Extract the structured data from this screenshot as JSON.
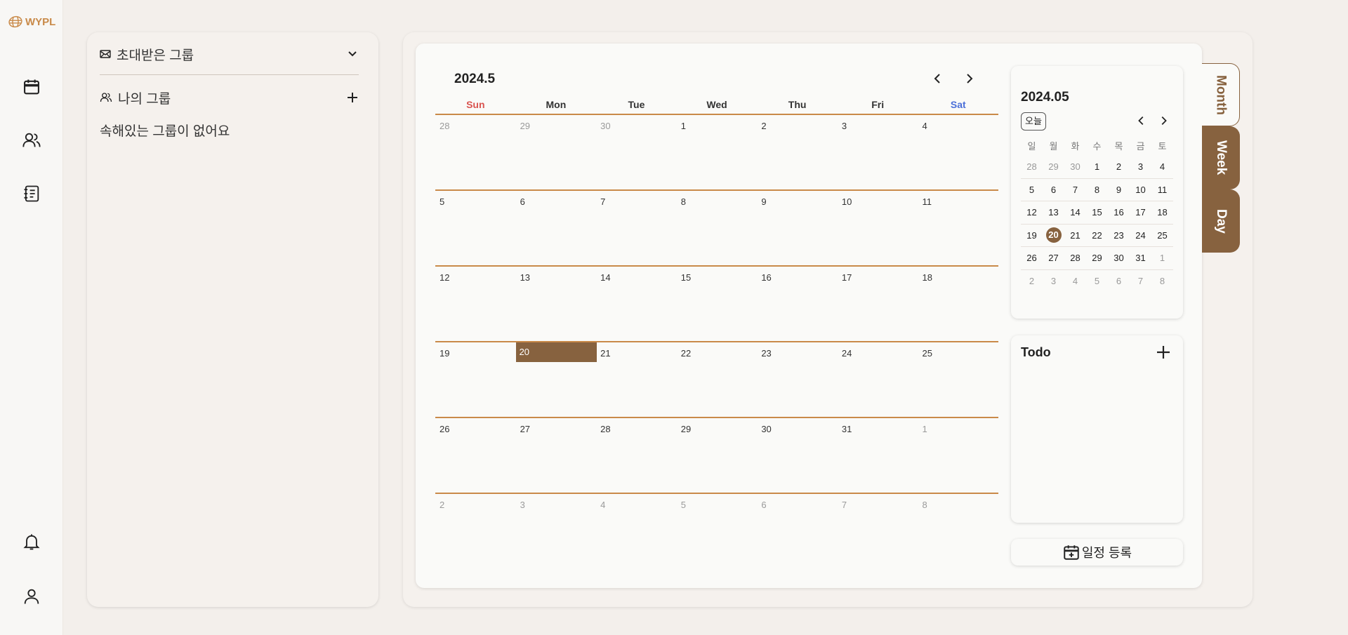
{
  "app": {
    "logo_text": "WYPL"
  },
  "sidebar": {
    "items": [
      {
        "name": "calendar-icon"
      },
      {
        "name": "group-icon"
      },
      {
        "name": "notebook-icon"
      },
      {
        "name": "bell-icon"
      },
      {
        "name": "user-icon"
      }
    ]
  },
  "groups": {
    "invited_label": "초대받은 그룹",
    "my_label": "나의 그룹",
    "empty_text": "속해있는 그룹이 없어요"
  },
  "calendar": {
    "title": "2024.5",
    "weekdays": [
      "Sun",
      "Mon",
      "Tue",
      "Wed",
      "Thu",
      "Fri",
      "Sat"
    ],
    "weeks": [
      [
        [
          "28",
          true
        ],
        [
          "29",
          true
        ],
        [
          "30",
          true
        ],
        [
          "1",
          false
        ],
        [
          "2",
          false
        ],
        [
          "3",
          false
        ],
        [
          "4",
          false
        ]
      ],
      [
        [
          "5",
          false
        ],
        [
          "6",
          false
        ],
        [
          "7",
          false
        ],
        [
          "8",
          false
        ],
        [
          "9",
          false
        ],
        [
          "10",
          false
        ],
        [
          "11",
          false
        ]
      ],
      [
        [
          "12",
          false
        ],
        [
          "13",
          false
        ],
        [
          "14",
          false
        ],
        [
          "15",
          false
        ],
        [
          "16",
          false
        ],
        [
          "17",
          false
        ],
        [
          "18",
          false
        ]
      ],
      [
        [
          "19",
          false
        ],
        [
          "20",
          false
        ],
        [
          "21",
          false
        ],
        [
          "22",
          false
        ],
        [
          "23",
          false
        ],
        [
          "24",
          false
        ],
        [
          "25",
          false
        ]
      ],
      [
        [
          "26",
          false
        ],
        [
          "27",
          false
        ],
        [
          "28",
          false
        ],
        [
          "29",
          false
        ],
        [
          "30",
          false
        ],
        [
          "31",
          false
        ],
        [
          "1",
          true
        ]
      ],
      [
        [
          "2",
          true
        ],
        [
          "3",
          true
        ],
        [
          "4",
          true
        ],
        [
          "5",
          true
        ],
        [
          "6",
          true
        ],
        [
          "7",
          true
        ],
        [
          "8",
          true
        ]
      ]
    ],
    "today": "20",
    "today_color": "#87623f",
    "line_color": "#c98a49",
    "sun_color": "#d9534f",
    "sat_color": "#4b6fd8"
  },
  "mini_calendar": {
    "title": "2024.05",
    "today_button": "오늘",
    "weekdays": [
      "일",
      "월",
      "화",
      "수",
      "목",
      "금",
      "토"
    ],
    "weeks": [
      [
        [
          "28",
          true
        ],
        [
          "29",
          true
        ],
        [
          "30",
          true
        ],
        [
          "1",
          false
        ],
        [
          "2",
          false
        ],
        [
          "3",
          false
        ],
        [
          "4",
          false
        ]
      ],
      [
        [
          "5",
          false
        ],
        [
          "6",
          false
        ],
        [
          "7",
          false
        ],
        [
          "8",
          false
        ],
        [
          "9",
          false
        ],
        [
          "10",
          false
        ],
        [
          "11",
          false
        ]
      ],
      [
        [
          "12",
          false
        ],
        [
          "13",
          false
        ],
        [
          "14",
          false
        ],
        [
          "15",
          false
        ],
        [
          "16",
          false
        ],
        [
          "17",
          false
        ],
        [
          "18",
          false
        ]
      ],
      [
        [
          "19",
          false
        ],
        [
          "20",
          false
        ],
        [
          "21",
          false
        ],
        [
          "22",
          false
        ],
        [
          "23",
          false
        ],
        [
          "24",
          false
        ],
        [
          "25",
          false
        ]
      ],
      [
        [
          "26",
          false
        ],
        [
          "27",
          false
        ],
        [
          "28",
          false
        ],
        [
          "29",
          false
        ],
        [
          "30",
          false
        ],
        [
          "31",
          false
        ],
        [
          "1",
          true
        ]
      ],
      [
        [
          "2",
          true
        ],
        [
          "3",
          true
        ],
        [
          "4",
          true
        ],
        [
          "5",
          true
        ],
        [
          "6",
          true
        ],
        [
          "7",
          true
        ],
        [
          "8",
          true
        ]
      ]
    ],
    "today": "20"
  },
  "todo": {
    "title": "Todo"
  },
  "schedule_button": {
    "label": "일정 등록"
  },
  "view_tabs": {
    "month": "Month",
    "week": "Week",
    "day": "Day",
    "selected": "Month"
  }
}
